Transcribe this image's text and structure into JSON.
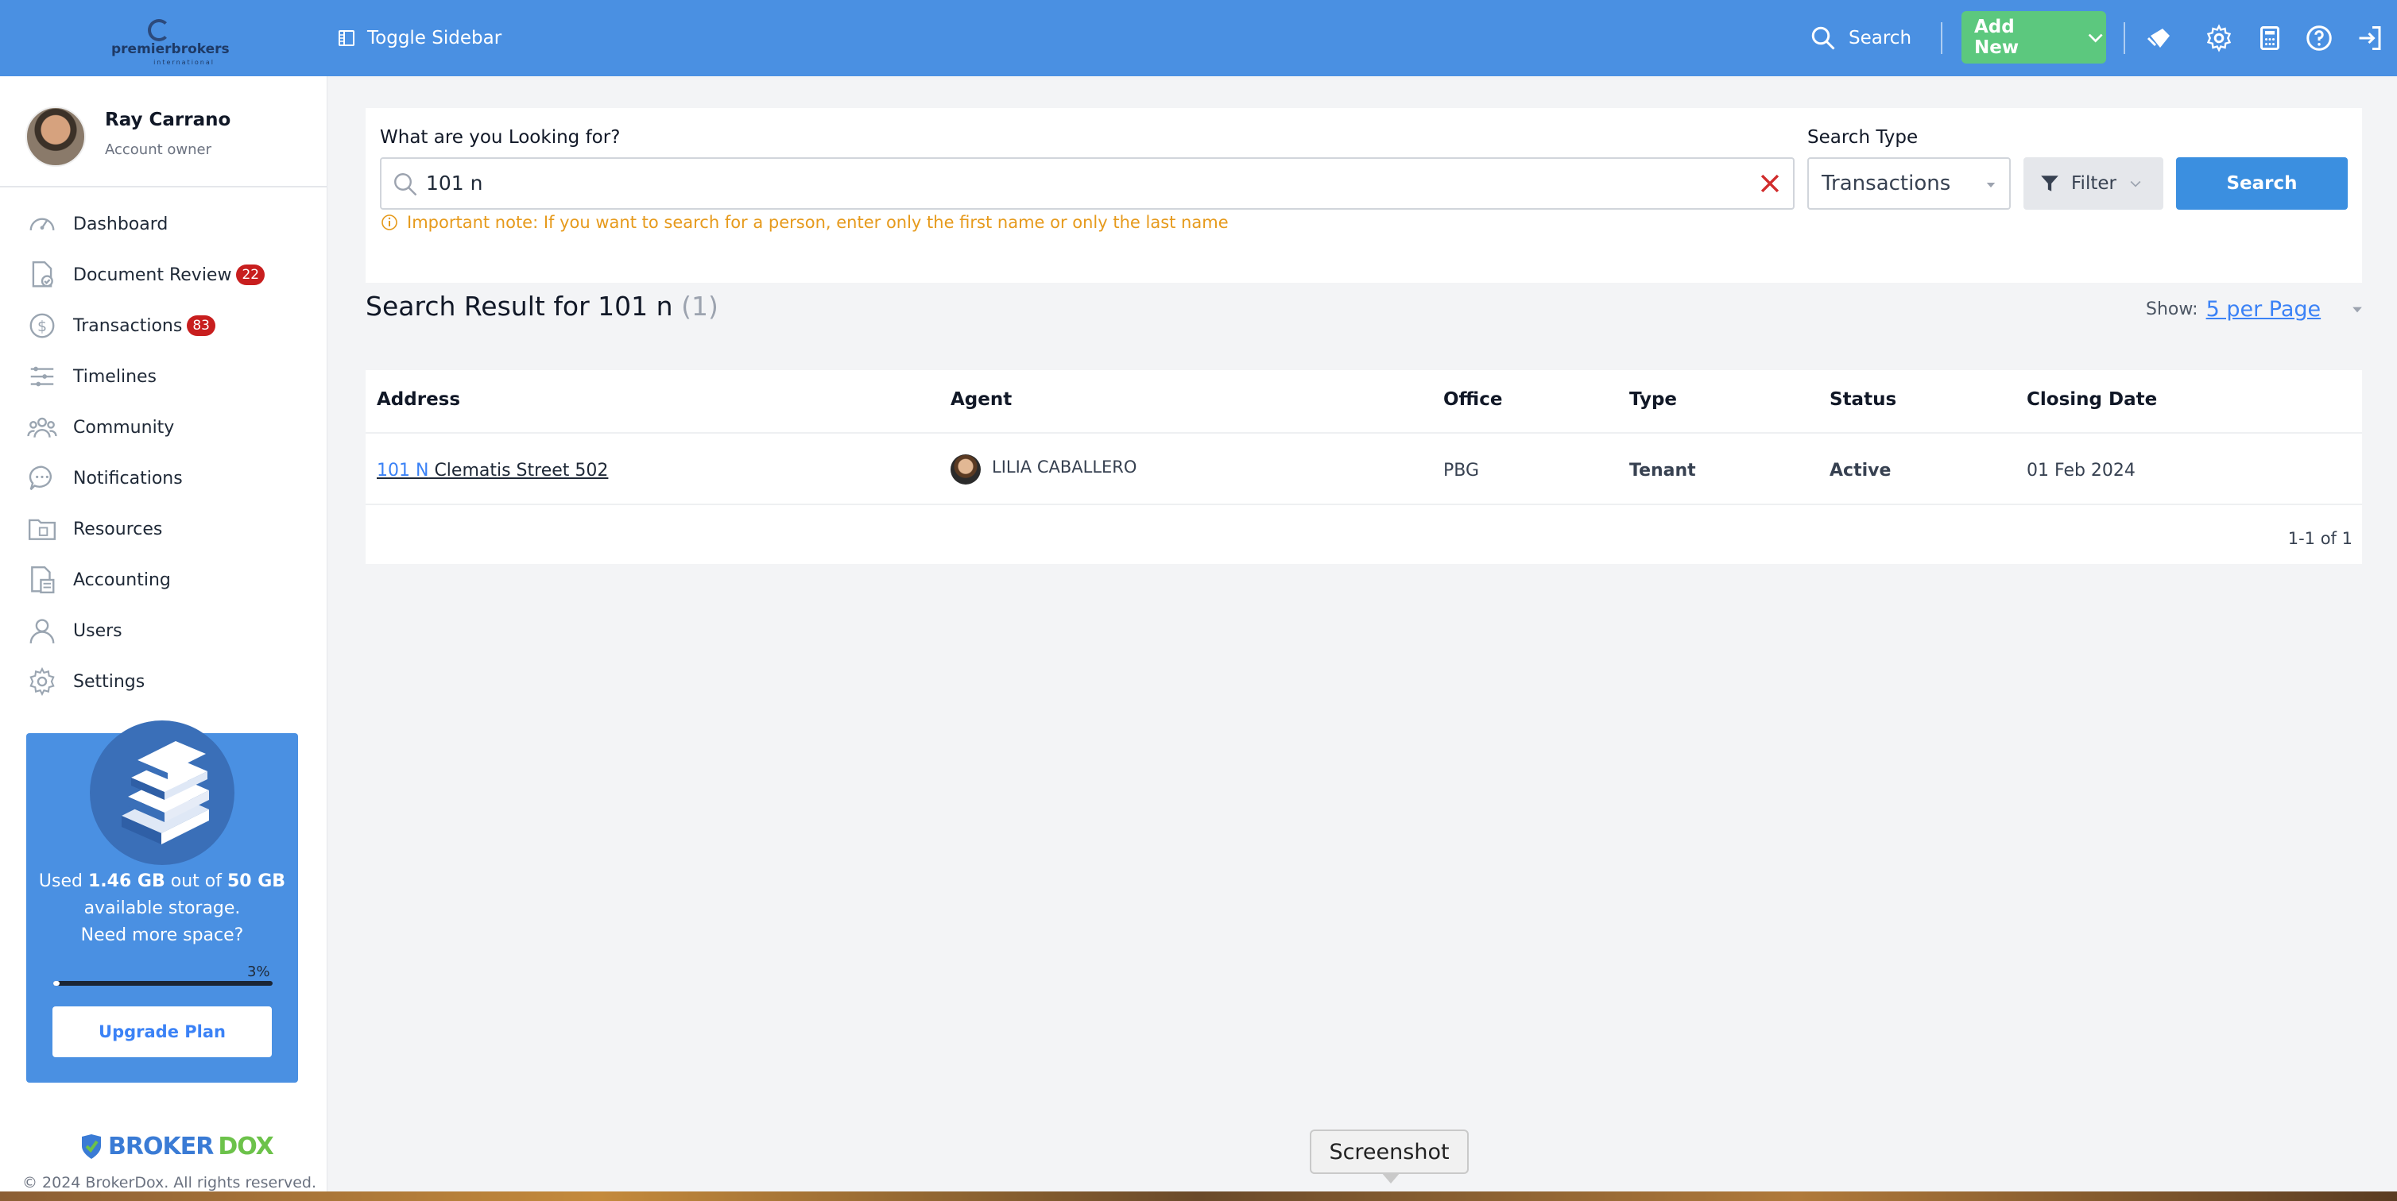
{
  "topbar": {
    "logo_text": "premierbrokers",
    "logo_sub": "international",
    "toggle_label": "Toggle Sidebar",
    "search_label": "Search",
    "add_new_label": "Add New",
    "icons": [
      "notifications-icon",
      "settings-icon",
      "calculator-icon",
      "help-icon",
      "logout-icon"
    ],
    "accent": "#4a90e2"
  },
  "profile": {
    "name": "Ray Carrano",
    "role": "Account owner"
  },
  "sidebar": {
    "items": [
      {
        "label": "Dashboard",
        "icon": "gauge-icon",
        "badge": ""
      },
      {
        "label": "Document Review",
        "icon": "document-check-icon",
        "badge": "22"
      },
      {
        "label": "Transactions",
        "icon": "dollar-icon",
        "badge": "83"
      },
      {
        "label": "Timelines",
        "icon": "timeline-icon",
        "badge": ""
      },
      {
        "label": "Community",
        "icon": "community-icon",
        "badge": ""
      },
      {
        "label": "Notifications",
        "icon": "chat-icon",
        "badge": ""
      },
      {
        "label": "Resources",
        "icon": "folder-icon",
        "badge": ""
      },
      {
        "label": "Accounting",
        "icon": "accounting-icon",
        "badge": ""
      },
      {
        "label": "Users",
        "icon": "user-icon",
        "badge": ""
      },
      {
        "label": "Settings",
        "icon": "gear-icon",
        "badge": ""
      }
    ],
    "badge_color": "#c81e1e"
  },
  "storage": {
    "used_prefix": "Used ",
    "used": "1.46 GB",
    "mid": " out of ",
    "total": "50 GB",
    "suffix": " available storage.",
    "question": "Need more space?",
    "percent_label": "3%",
    "percent": 3,
    "upgrade_label": "Upgrade Plan"
  },
  "footer": {
    "brand_a": "BROKER",
    "brand_b": "DOX",
    "copyright": "© 2024 BrokerDox. All rights reserved."
  },
  "search": {
    "question_label": "What are you Looking for?",
    "query": "101 n",
    "note": "Important note: If you want to search for a person, enter only the first name or only the last name",
    "type_label": "Search Type",
    "type_value": "Transactions",
    "filter_label": "Filter",
    "search_button": "Search"
  },
  "results": {
    "title_prefix": "Search Result for 101 n",
    "count": "(1)",
    "show_label": "Show:",
    "per_page": "5 per Page",
    "columns": [
      "Address",
      "Agent",
      "Office",
      "Type",
      "Status",
      "Closing Date"
    ],
    "rows": [
      {
        "address_highlight": "101 N",
        "address_rest": " Clematis Street 502",
        "agent": "LILIA CABALLERO",
        "office": "PBG",
        "type": "Tenant",
        "status": "Active",
        "closing_date": "01 Feb 2024"
      }
    ],
    "pager": "1-1 of 1"
  },
  "tooltip": {
    "label": "Screenshot"
  }
}
